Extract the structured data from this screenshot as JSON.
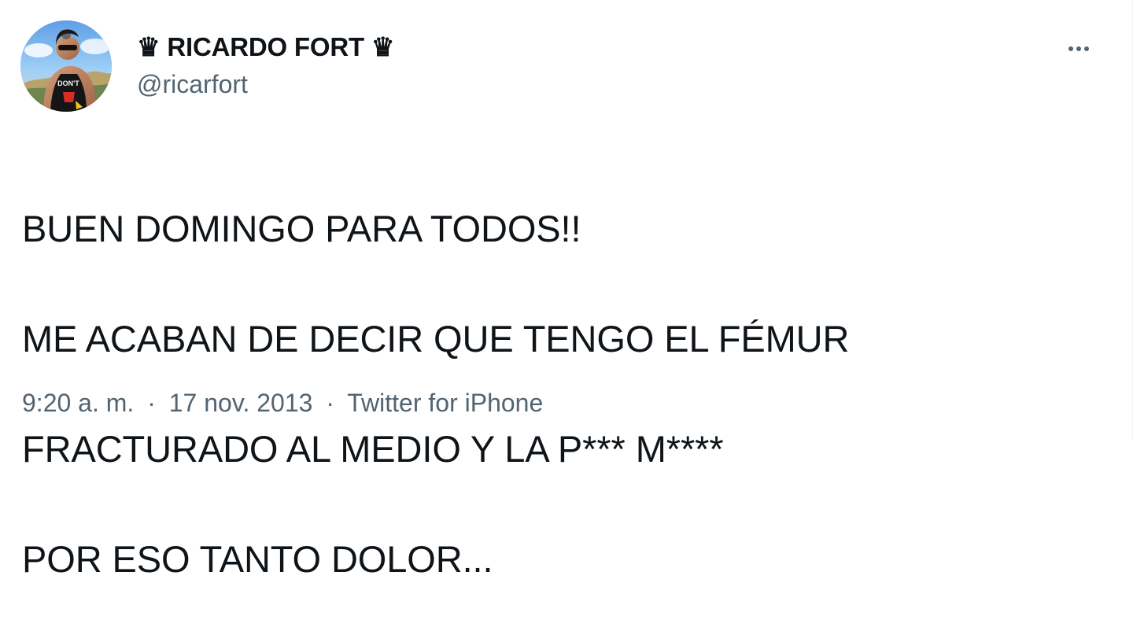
{
  "tweet": {
    "author": {
      "display_name": "♛ RICARDO FORT ♛",
      "handle": "@ricarfort",
      "avatar_shirt_text": "DON'T"
    },
    "more_icon": "more-horizontal-icon",
    "text_lines": [
      "BUEN DOMINGO PARA TODOS!!",
      "ME ACABAN DE DECIR QUE TENGO EL FÉMUR",
      "FRACTURADO AL MEDIO Y LA P*** M****",
      "POR ESO TANTO DOLOR..."
    ],
    "meta": {
      "time": "9:20 a. m.",
      "separator": "·",
      "date": "17 nov. 2013",
      "source": "Twitter for iPhone"
    }
  },
  "colors": {
    "text_primary": "#0f1419",
    "text_secondary": "#536471",
    "background": "#ffffff"
  }
}
